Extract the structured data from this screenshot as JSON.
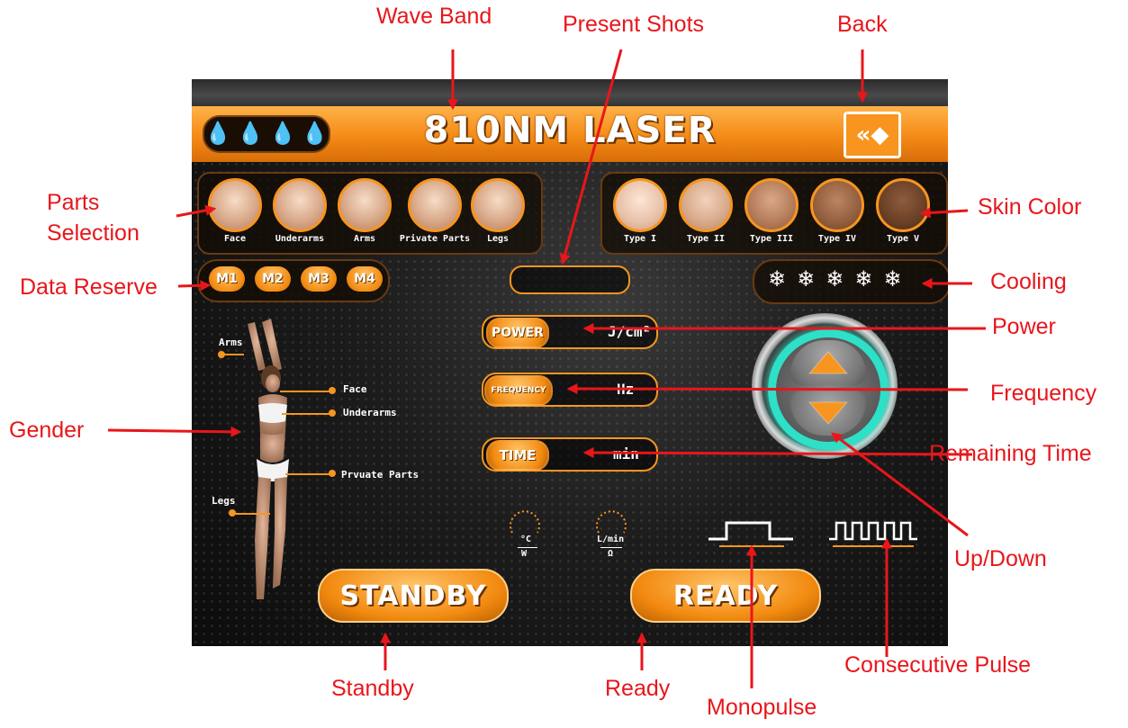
{
  "screen": {
    "title": "810NM LASER",
    "wave_band_drops": [
      "💧",
      "💧",
      "💧",
      "💧"
    ],
    "back_icon": "«◆"
  },
  "parts": [
    {
      "label": "Face"
    },
    {
      "label": "Underarms"
    },
    {
      "label": "Arms"
    },
    {
      "label": "Private Parts"
    },
    {
      "label": "Legs"
    }
  ],
  "skin_types": [
    {
      "label": "Type I"
    },
    {
      "label": "Type II"
    },
    {
      "label": "Type III"
    },
    {
      "label": "Type IV"
    },
    {
      "label": "Type V"
    }
  ],
  "memory": [
    "M1",
    "M2",
    "M3",
    "M4"
  ],
  "cooling_icons": [
    "❄",
    "❄",
    "❄",
    "❄",
    "❄"
  ],
  "params": {
    "power_label": "POWER",
    "power_unit": "J/cm²",
    "frequency_label": "FREQUENCY",
    "frequency_unit": "Hz",
    "time_label": "TIME",
    "time_unit": "min"
  },
  "gauges": {
    "temp_unit_top": "°C",
    "temp_unit_bottom": "W",
    "flow_unit_top": "L/min",
    "flow_unit_bottom": "Ω"
  },
  "body_labels": {
    "arms": "Arms",
    "face": "Face",
    "underarms": "Underarms",
    "private": "Prvuate Parts",
    "legs": "Legs"
  },
  "buttons": {
    "standby": "STANDBY",
    "ready": "READY"
  },
  "callouts": {
    "wave_band": "Wave Band",
    "present_shots": "Present Shots",
    "back": "Back",
    "parts_selection_1": "Parts",
    "parts_selection_2": "Selection",
    "skin_color": "Skin Color",
    "data_reserve": "Data Reserve",
    "cooling": "Cooling",
    "power": "Power",
    "frequency": "Frequency",
    "gender": "Gender",
    "remaining_time": "Remaining Time",
    "up_down": "Up/Down",
    "standby": "Standby",
    "ready": "Ready",
    "monopulse": "Monopulse",
    "consecutive_pulse": "Consecutive Pulse"
  },
  "colors": {
    "accent": "#f7951f",
    "callout": "#e8161b",
    "teal": "#2ee0c8"
  }
}
